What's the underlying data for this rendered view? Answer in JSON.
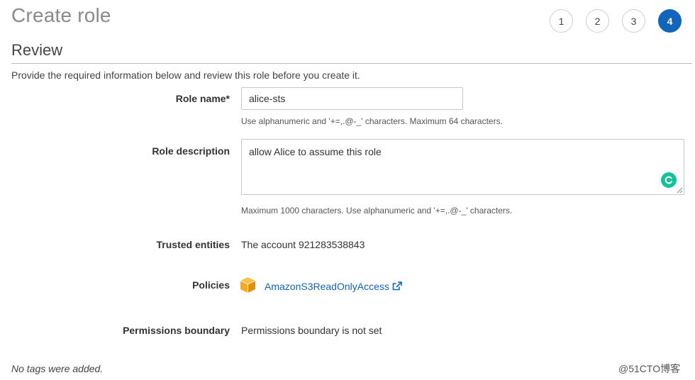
{
  "header": {
    "title": "Create role",
    "steps": [
      "1",
      "2",
      "3",
      "4"
    ],
    "active_step": "4"
  },
  "review": {
    "section_title": "Review",
    "intro": "Provide the required information below and review this role before you create it."
  },
  "form": {
    "role_name": {
      "label": "Role name*",
      "value": "alice-sts",
      "hint": "Use alphanumeric and '+=,.@-_' characters. Maximum 64 characters."
    },
    "role_description": {
      "label": "Role description",
      "value": "allow Alice to assume this role",
      "hint": "Maximum 1000 characters. Use alphanumeric and '+=,.@-_' characters."
    },
    "trusted_entities": {
      "label": "Trusted entities",
      "value": "The account 921283538843"
    },
    "policies": {
      "label": "Policies",
      "items": [
        {
          "name": "AmazonS3ReadOnlyAccess",
          "icon": "aws-policy-cube-icon"
        }
      ]
    },
    "permissions_boundary": {
      "label": "Permissions boundary",
      "value": "Permissions boundary is not set"
    }
  },
  "tags": {
    "empty_text": "No tags were added."
  },
  "watermark": "@51CTO博客",
  "colors": {
    "accent": "#1166bb",
    "policy_icon": "#f7a81b",
    "grammarly": "#15c39a"
  }
}
